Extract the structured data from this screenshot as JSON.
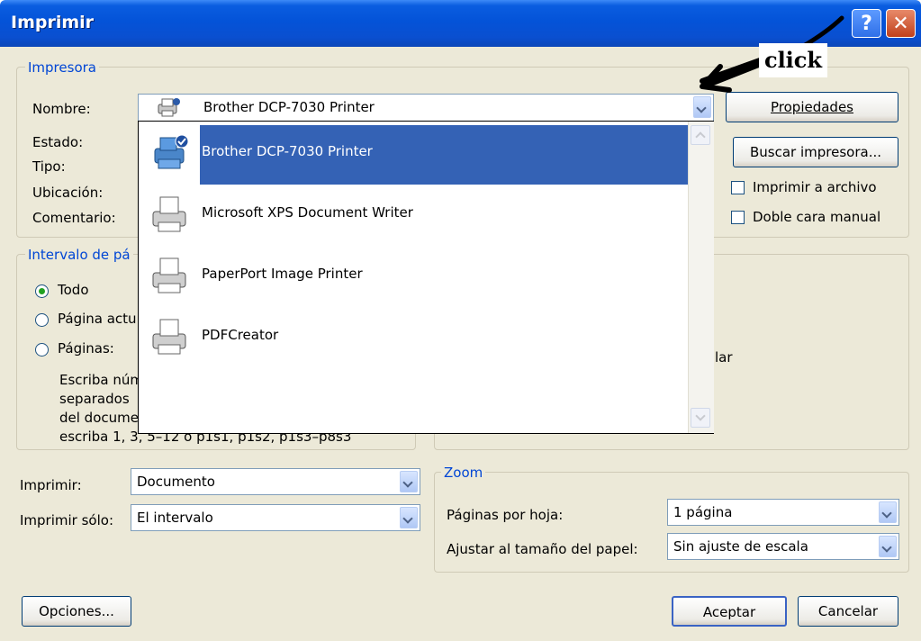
{
  "window": {
    "title": "Imprimir"
  },
  "printer": {
    "legend": "Impresora",
    "name_label": "Nombre:",
    "status_label": "Estado:",
    "type_label": "Tipo:",
    "location_label": "Ubicación:",
    "comment_label": "Comentario:",
    "selected": "Brother DCP-7030 Printer",
    "properties_button": "Propiedades",
    "find_button": "Buscar impresora...",
    "print_to_file": "Imprimir a archivo",
    "manual_duplex": "Doble cara manual"
  },
  "dropdown": {
    "items": [
      {
        "label": "Brother DCP-7030 Printer",
        "icon": "printer-default-icon",
        "selected": true
      },
      {
        "label": "Microsoft XPS Document Writer",
        "icon": "printer-icon",
        "selected": false
      },
      {
        "label": "PaperPort Image Printer",
        "icon": "printer-icon",
        "selected": false
      },
      {
        "label": "PDFCreator",
        "icon": "printer-icon",
        "selected": false
      }
    ]
  },
  "range": {
    "legend": "Intervalo de pá",
    "all": "Todo",
    "current": "Página actu",
    "pages": "Páginas:",
    "help1": "Escriba núm",
    "help2": "separados",
    "help3": "del docume",
    "help4": "escriba 1, 3, 5–12 o p1s1, p1s2, p1s3–p8s3"
  },
  "copies": {
    "partial_text": "lar"
  },
  "print": {
    "print_label": "Imprimir:",
    "print_value": "Documento",
    "only_label": "Imprimir sólo:",
    "only_value": "El intervalo"
  },
  "zoom": {
    "legend": "Zoom",
    "pages_per_sheet_label": "Páginas por hoja:",
    "pages_per_sheet_value": "1 página",
    "scale_label": "Ajustar al tamaño del papel:",
    "scale_value": "Sin ajuste de escala"
  },
  "footer": {
    "options_button": "Opciones...",
    "ok_button": "Aceptar",
    "cancel_button": "Cancelar"
  },
  "annotation": {
    "text": "click"
  }
}
